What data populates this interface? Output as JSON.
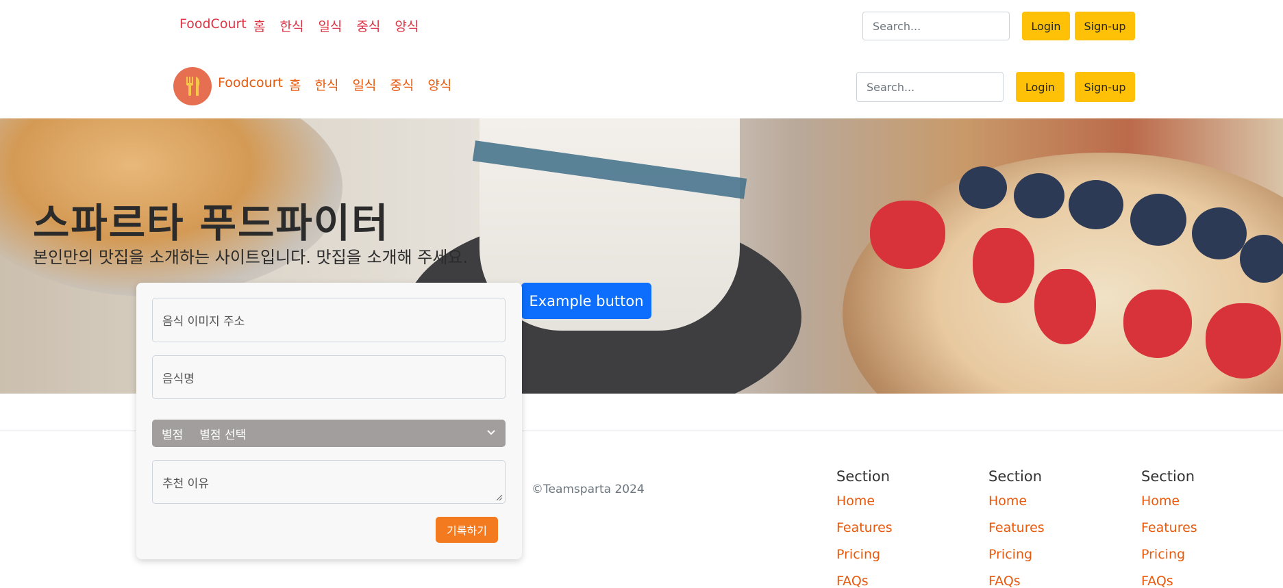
{
  "nav_top": {
    "brand": "FoodCourt",
    "links": [
      "홈",
      "한식",
      "일식",
      "중식",
      "양식"
    ],
    "search_placeholder": "Search...",
    "login": "Login",
    "signup": "Sign-up"
  },
  "nav_main": {
    "logo_icon": "fork-knife-icon",
    "brand": "Foodcourt",
    "links": [
      "홈",
      "한식",
      "일식",
      "중식",
      "양식"
    ],
    "search_placeholder": "Search...",
    "login": "Login",
    "signup": "Sign-up"
  },
  "hero": {
    "title": "스파르타 푸드파이터",
    "subtitle": "본인만의 맛집을 소개하는 사이트입니다. 맛집을 소개해 주세요.",
    "button": "Example button"
  },
  "form": {
    "image_url_placeholder": "음식 이미지 주소",
    "food_name_placeholder": "음식명",
    "rating_label": "별점",
    "rating_value": "별점 선택",
    "reason_placeholder": "추천 이유",
    "submit": "기록하기"
  },
  "footer": {
    "copyright": "©Teamsparta 2024",
    "columns": [
      {
        "title": "Section",
        "items": [
          "Home",
          "Features",
          "Pricing",
          "FAQs"
        ]
      },
      {
        "title": "Section",
        "items": [
          "Home",
          "Features",
          "Pricing",
          "FAQs"
        ]
      },
      {
        "title": "Section",
        "items": [
          "Home",
          "Features",
          "Pricing",
          "FAQs"
        ]
      }
    ]
  },
  "colors": {
    "accent_orange": "#e8590c",
    "accent_red": "#dc3545",
    "button_yellow": "#ffc107",
    "primary_blue": "#0d6efd",
    "submit_orange": "#f47a20"
  }
}
